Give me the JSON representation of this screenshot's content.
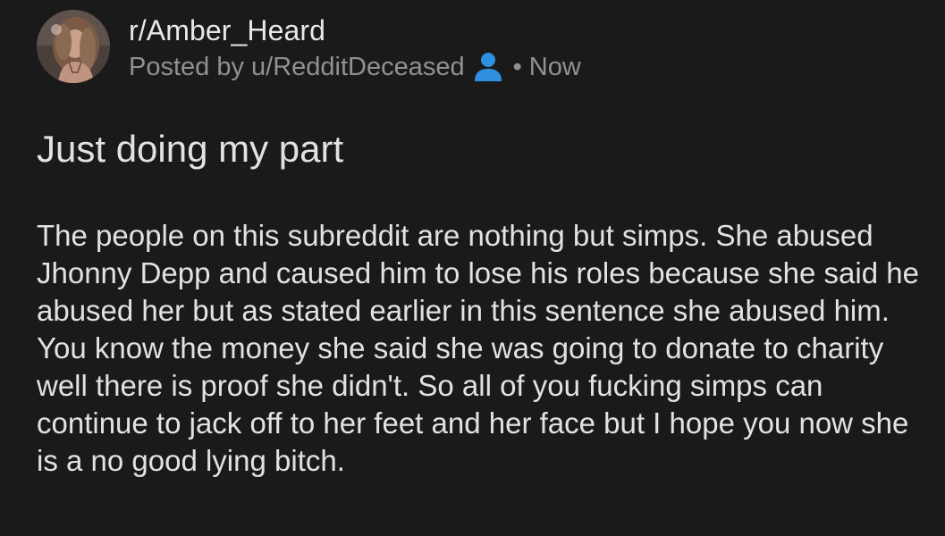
{
  "post": {
    "subreddit": "r/Amber_Heard",
    "posted_by": "Posted by u/RedditDeceased",
    "separator": "•",
    "time": "Now",
    "title": "Just doing my part",
    "body": "The people on this subreddit are nothing but simps. She abused Jhonny Depp and caused him to lose his roles because she said he abused her but as stated earlier in this sentence she abused him. You know the money she said she was going to donate to charity well there is proof she didn't. So all of you fucking simps can continue to jack off to her feet and her face but I hope you now she is a no good lying bitch."
  },
  "icons": {
    "avatar": "subreddit-avatar",
    "user": "user-icon"
  },
  "colors": {
    "background": "#1a1a1b",
    "text_primary": "#e2e2e2",
    "text_secondary": "#8f9293",
    "user_icon": "#2f8fe0"
  }
}
